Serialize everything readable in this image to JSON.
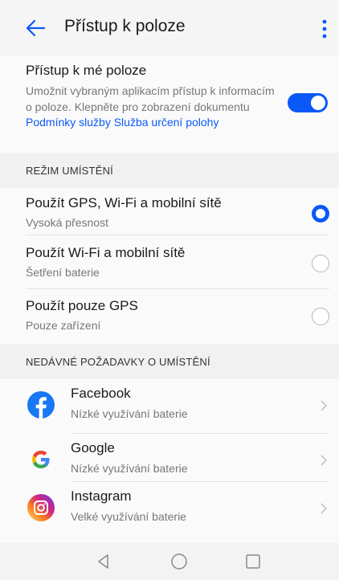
{
  "appbar": {
    "title": "Přístup k poloze",
    "back_icon": "arrow-left-icon",
    "more_icon": "more-vertical-icon"
  },
  "location_access": {
    "title": "Přístup k mé poloze",
    "description": "Umožnit vybraným aplikacím přístup k informacím o poloze. Klepněte pro zobrazení dokumentu",
    "link_text": "Podmínky služby Služba určení polohy",
    "toggle_on": true
  },
  "mode_header": "REŽIM UMÍSTĚNÍ",
  "modes": [
    {
      "title": "Použít GPS, Wi-Fi a mobilní sítě",
      "subtitle": "Vysoká přesnost",
      "selected": true
    },
    {
      "title": "Použít Wi-Fi a mobilní sítě",
      "subtitle": "Šetření baterie",
      "selected": false
    },
    {
      "title": "Použít pouze GPS",
      "subtitle": "Pouze zařízení",
      "selected": false
    }
  ],
  "recent_header": "NEDÁVNÉ POŽADAVKY O UMÍSTĚNÍ",
  "apps": [
    {
      "name": "Facebook",
      "usage": "Nízké využívání baterie",
      "icon": "facebook-icon"
    },
    {
      "name": "Google",
      "usage": "Nízké využívání baterie",
      "icon": "google-icon"
    },
    {
      "name": "Instagram",
      "usage": "Velké využívání baterie",
      "icon": "instagram-icon"
    }
  ],
  "navbar": {
    "back_icon": "nav-back-icon",
    "home_icon": "nav-home-icon",
    "recents_icon": "nav-recents-icon"
  },
  "colors": {
    "accent": "#0a59f7",
    "background": "#f5f5f5"
  }
}
